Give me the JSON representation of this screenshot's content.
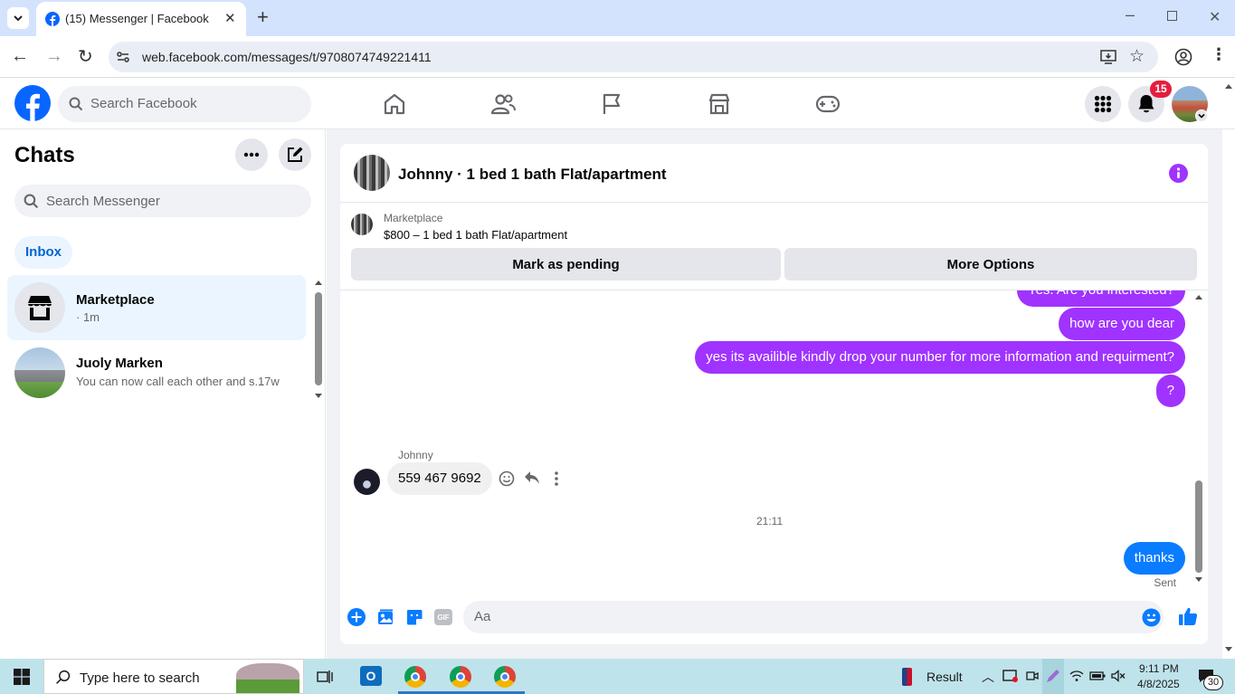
{
  "browser": {
    "tab_title": "(15) Messenger | Facebook",
    "url": "web.facebook.com/messages/t/9708074749221411"
  },
  "header": {
    "search_placeholder": "Search Facebook",
    "notification_count": "15"
  },
  "chats": {
    "title": "Chats",
    "search_placeholder": "Search Messenger",
    "filter_label": "Inbox",
    "items": [
      {
        "name": "Marketplace",
        "preview": "· 1m"
      },
      {
        "name": "Juoly Marken",
        "preview": "You can now call each other and s...",
        "time": "· 17w"
      }
    ]
  },
  "conversation": {
    "title": "Johnny · 1 bed 1 bath Flat/apartment",
    "listing_source": "Marketplace",
    "listing_title": "$800 – 1 bed 1 bath Flat/apartment",
    "mark_pending_label": "Mark as pending",
    "more_options_label": "More Options",
    "messages": [
      {
        "text": "Yes. Are you interested?"
      },
      {
        "text": "how are you dear"
      },
      {
        "text": "yes its availible kindly drop your number for more information and requirment?"
      },
      {
        "text": "?"
      }
    ],
    "incoming_sender": "Johnny",
    "incoming_text": "559 467 9692",
    "timestamp": "21:11",
    "last_sent_text": "thanks",
    "sent_status": "Sent",
    "composer_placeholder": "Aa",
    "gif_label": "GIF"
  },
  "taskbar": {
    "search_placeholder": "Type here to search",
    "weather_label": "Result",
    "time": "9:11 PM",
    "date": "4/8/2025",
    "notification_count": "30"
  },
  "colors": {
    "facebook_blue": "#0866ff",
    "messenger_purple": "#a033ff",
    "sent_blue": "#0a7cff",
    "badge_red": "#e41e3f"
  }
}
